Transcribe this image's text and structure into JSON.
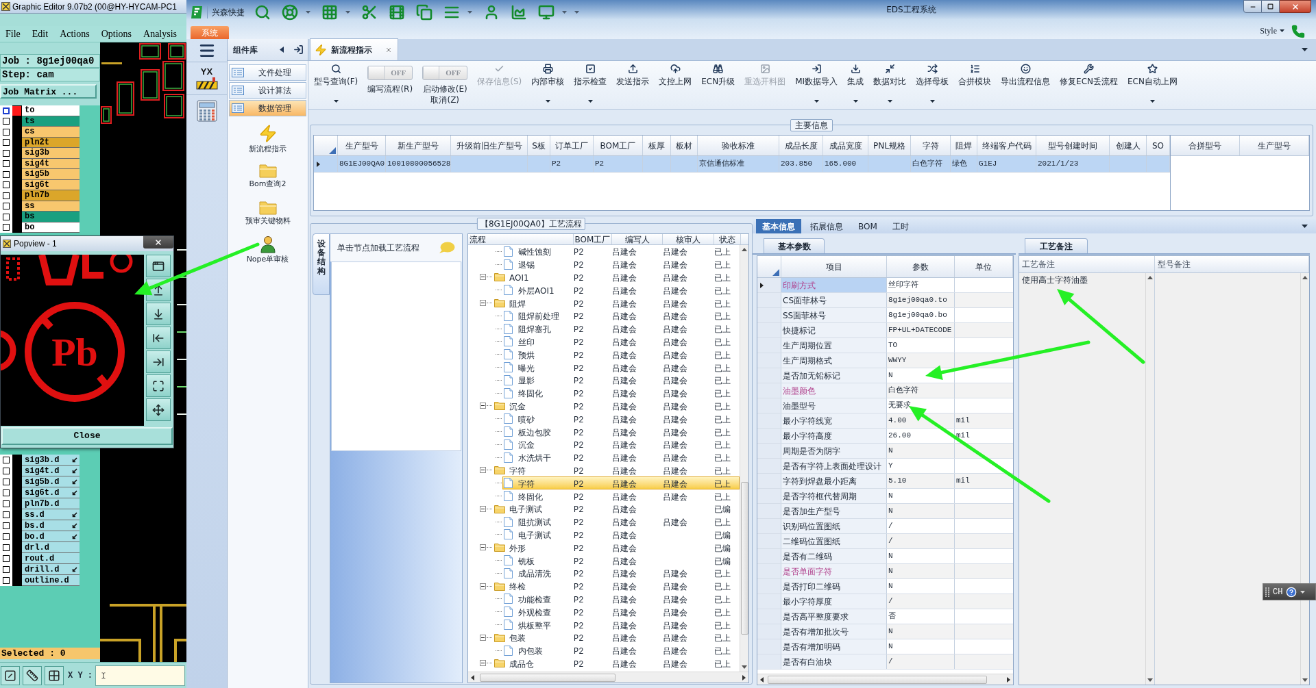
{
  "editor": {
    "title": "Graphic Editor 9.07b2 (00@HY-HYCAM-PC1",
    "menus": [
      "File",
      "Edit",
      "Actions",
      "Options",
      "Analysis"
    ],
    "job": "Job : 8g1ej00qa0",
    "step": "Step: cam",
    "job_matrix_button": "Job Matrix ...",
    "layers": [
      {
        "name": "to",
        "color": "#ffffff",
        "active": true,
        "checked": false
      },
      {
        "name": "ts",
        "color": "#1aa080",
        "active": false,
        "checked": false
      },
      {
        "name": "cs",
        "color": "#f8c76e",
        "active": false,
        "checked": false
      },
      {
        "name": "pln2t",
        "color": "#dba62a",
        "active": false,
        "checked": false
      },
      {
        "name": "sig3b",
        "color": "#f8c76e",
        "active": false,
        "checked": false
      },
      {
        "name": "sig4t",
        "color": "#f8c76e",
        "active": false,
        "checked": false
      },
      {
        "name": "sig5b",
        "color": "#f8c76e",
        "active": false,
        "checked": false
      },
      {
        "name": "sig6t",
        "color": "#f8c76e",
        "active": false,
        "checked": false
      },
      {
        "name": "pln7b",
        "color": "#dba62a",
        "active": false,
        "checked": false
      },
      {
        "name": "ss",
        "color": "#f8c76e",
        "active": false,
        "checked": false
      },
      {
        "name": "bs",
        "color": "#1aa080",
        "active": false,
        "checked": false
      },
      {
        "name": "bo",
        "color": "#ffffff",
        "active": false,
        "checked": false
      }
    ],
    "drill_layers": [
      {
        "name": "sig3b.d",
        "linked": true,
        "checked": false
      },
      {
        "name": "sig4t.d",
        "linked": true,
        "checked": false
      },
      {
        "name": "sig5b.d",
        "linked": true,
        "checked": false
      },
      {
        "name": "sig6t.d",
        "linked": true,
        "checked": false
      },
      {
        "name": "pln7b.d",
        "linked": false,
        "checked": false
      },
      {
        "name": "ss.d",
        "linked": true,
        "checked": false
      },
      {
        "name": "bs.d",
        "linked": true,
        "checked": false
      },
      {
        "name": "bo.d",
        "linked": true,
        "checked": false
      },
      {
        "name": "drl.d",
        "linked": false,
        "checked": false
      },
      {
        "name": "rout.d",
        "linked": false,
        "checked": false
      },
      {
        "name": "drill.d",
        "linked": true,
        "checked": false
      },
      {
        "name": "outline.d",
        "linked": false,
        "checked": false
      }
    ],
    "selected_count": "Selected : 0",
    "xy_label": "X Y :"
  },
  "popview": {
    "title": "Popview - 1",
    "symbol_text": "Pb",
    "close_button": "Close"
  },
  "window": {
    "brand": "兴森快捷",
    "title": "EDS工程系统",
    "ribbon_tabs": [
      {
        "label": "系统",
        "selected": true
      }
    ],
    "style_menu": "Style",
    "badge_text": "YX"
  },
  "library": {
    "title": "组件库",
    "categories": [
      {
        "label": "文件处理",
        "selected": false
      },
      {
        "label": "设计算法",
        "selected": false
      },
      {
        "label": "数据管理",
        "selected": true
      }
    ],
    "tools": [
      {
        "label": "新流程指示",
        "kind": "flow"
      },
      {
        "label": "Bom查询2",
        "kind": "folder"
      },
      {
        "label": "预审关键物料",
        "kind": "folder"
      },
      {
        "label": "Nope单审核",
        "kind": "user"
      }
    ]
  },
  "doc_tabs": [
    {
      "label": "新流程指示",
      "selected": true
    }
  ],
  "toolbar": [
    {
      "kind": "button",
      "label": "型号查询(F)",
      "dropdown": true,
      "disabled": false
    },
    {
      "kind": "toggle",
      "switch_text": "OFF",
      "on": false,
      "label": "编写流程(R)"
    },
    {
      "kind": "toggle",
      "switch_text": "OFF",
      "on": false,
      "label": "启动修改(E)",
      "sublabel": "取消(Z)"
    },
    {
      "kind": "button",
      "label": "保存信息(S)",
      "dropdown": false,
      "disabled": true
    },
    {
      "kind": "button",
      "label": "内部审核",
      "dropdown": true,
      "disabled": false
    },
    {
      "kind": "button",
      "label": "指示检查",
      "dropdown": true,
      "disabled": false
    },
    {
      "kind": "button",
      "label": "发送指示",
      "dropdown": false,
      "disabled": false
    },
    {
      "kind": "button",
      "label": "文控上网",
      "dropdown": false,
      "disabled": false
    },
    {
      "kind": "button",
      "label": "ECN升级",
      "dropdown": false,
      "disabled": false
    },
    {
      "kind": "button",
      "label": "重选开料图",
      "dropdown": false,
      "disabled": true
    },
    {
      "kind": "button",
      "label": "MI数据导入",
      "dropdown": true,
      "disabled": false
    },
    {
      "kind": "button",
      "label": "集成",
      "dropdown": true,
      "disabled": false
    },
    {
      "kind": "button",
      "label": "数据对比",
      "dropdown": true,
      "disabled": false
    },
    {
      "kind": "button",
      "label": "选择母板",
      "dropdown": true,
      "disabled": false
    },
    {
      "kind": "button",
      "label": "合拼模块",
      "dropdown": false,
      "disabled": false
    },
    {
      "kind": "button",
      "label": "导出流程信息",
      "dropdown": false,
      "disabled": false
    },
    {
      "kind": "button",
      "label": "修复ECN丢流程",
      "dropdown": false,
      "disabled": false
    },
    {
      "kind": "button",
      "label": "ECN自动上网",
      "dropdown": true,
      "disabled": false
    }
  ],
  "main_info": {
    "legend": "主要信息",
    "columns": [
      "生产型号",
      "新生产型号",
      "升级前旧生产型号",
      "S板",
      "订单工厂",
      "BOM工厂",
      "板厚",
      "板材",
      "验收标准",
      "成品长度",
      "成品宽度",
      "PNL规格",
      "字符",
      "阻焊",
      "终端客户代码",
      "型号创建时间",
      "创建人",
      "SO"
    ],
    "rows": [
      {
        "selected": true,
        "cells": [
          "8G1EJ00QA0",
          "10010800056528",
          null,
          null,
          "P2",
          "P2",
          null,
          null,
          "京信通信标准",
          "203.850",
          "165.000",
          null,
          "白色字符",
          "绿色",
          "G1EJ",
          "2021/1/23",
          null,
          null
        ]
      }
    ],
    "side_columns": [
      "合拼型号",
      "生产型号"
    ]
  },
  "process": {
    "legend": "【8G1EJ00QA0】工艺流程",
    "side_tab": "设备结构",
    "hint": "单击节点加载工艺流程",
    "columns": [
      "流程",
      "BOM工厂",
      "编写人",
      "核审人",
      "状态"
    ],
    "tree": [
      {
        "kind": "file",
        "cells": [
          "碱性蚀刻",
          "P2",
          "吕建会",
          "吕建会",
          "已上"
        ],
        "selected": false
      },
      {
        "kind": "file",
        "cells": [
          "退锡",
          "P2",
          "吕建会",
          "吕建会",
          "已上"
        ],
        "selected": false
      },
      {
        "kind": "folder",
        "cells": [
          "AOI1",
          "P2",
          "吕建会",
          "吕建会",
          "已上"
        ],
        "expanded": true,
        "selected": false,
        "children": [
          {
            "kind": "file",
            "cells": [
              "外层AOI1",
              "P2",
              "吕建会",
              "吕建会",
              "已上"
            ],
            "selected": false
          }
        ]
      },
      {
        "kind": "folder",
        "cells": [
          "阻焊",
          "P2",
          "吕建会",
          "吕建会",
          "已上"
        ],
        "expanded": true,
        "selected": false,
        "children": [
          {
            "kind": "file",
            "cells": [
              "阻焊前处理",
              "P2",
              "吕建会",
              "吕建会",
              "已上"
            ],
            "selected": false
          },
          {
            "kind": "file",
            "cells": [
              "阻焊塞孔",
              "P2",
              "吕建会",
              "吕建会",
              "已上"
            ],
            "selected": false
          },
          {
            "kind": "file",
            "cells": [
              "丝印",
              "P2",
              "吕建会",
              "吕建会",
              "已上"
            ],
            "selected": false
          },
          {
            "kind": "file",
            "cells": [
              "预烘",
              "P2",
              "吕建会",
              "吕建会",
              "已上"
            ],
            "selected": false
          },
          {
            "kind": "file",
            "cells": [
              "曝光",
              "P2",
              "吕建会",
              "吕建会",
              "已上"
            ],
            "selected": false
          },
          {
            "kind": "file",
            "cells": [
              "显影",
              "P2",
              "吕建会",
              "吕建会",
              "已上"
            ],
            "selected": false
          },
          {
            "kind": "file",
            "cells": [
              "终固化",
              "P2",
              "吕建会",
              "吕建会",
              "已上"
            ],
            "selected": false
          }
        ]
      },
      {
        "kind": "folder",
        "cells": [
          "沉金",
          "P2",
          "吕建会",
          "吕建会",
          "已上"
        ],
        "expanded": true,
        "selected": false,
        "children": [
          {
            "kind": "file",
            "cells": [
              "喷砂",
              "P2",
              "吕建会",
              "吕建会",
              "已上"
            ],
            "selected": false
          },
          {
            "kind": "file",
            "cells": [
              "板边包胶",
              "P2",
              "吕建会",
              "吕建会",
              "已上"
            ],
            "selected": false
          },
          {
            "kind": "file",
            "cells": [
              "沉金",
              "P2",
              "吕建会",
              "吕建会",
              "已上"
            ],
            "selected": false
          },
          {
            "kind": "file",
            "cells": [
              "水洗烘干",
              "P2",
              "吕建会",
              "吕建会",
              "已上"
            ],
            "selected": false
          }
        ]
      },
      {
        "kind": "folder",
        "cells": [
          "字符",
          "P2",
          "吕建会",
          "吕建会",
          "已上"
        ],
        "expanded": true,
        "selected": false,
        "children": [
          {
            "kind": "file",
            "cells": [
              "字符",
              "P2",
              "吕建会",
              "吕建会",
              "已上"
            ],
            "selected": true
          },
          {
            "kind": "file",
            "cells": [
              "终固化",
              "P2",
              "吕建会",
              "吕建会",
              "已上"
            ],
            "selected": false
          }
        ]
      },
      {
        "kind": "folder",
        "cells": [
          "电子测试",
          "P2",
          "吕建会",
          null,
          "已编"
        ],
        "expanded": true,
        "selected": false,
        "children": [
          {
            "kind": "file",
            "cells": [
              "阻抗测试",
              "P2",
              "吕建会",
              "吕建会",
              "已上"
            ],
            "selected": false
          },
          {
            "kind": "file",
            "cells": [
              "电子测试",
              "P2",
              "吕建会",
              null,
              "已编"
            ],
            "selected": false
          }
        ]
      },
      {
        "kind": "folder",
        "cells": [
          "外形",
          "P2",
          "吕建会",
          null,
          "已编"
        ],
        "expanded": true,
        "selected": false,
        "children": [
          {
            "kind": "file",
            "cells": [
              "铣板",
              "P2",
              "吕建会",
              null,
              "已编"
            ],
            "selected": false
          },
          {
            "kind": "file",
            "cells": [
              "成品清洗",
              "P2",
              "吕建会",
              "吕建会",
              "已上"
            ],
            "selected": false
          }
        ]
      },
      {
        "kind": "folder",
        "cells": [
          "终检",
          "P2",
          "吕建会",
          "吕建会",
          "已上"
        ],
        "expanded": true,
        "selected": false,
        "children": [
          {
            "kind": "file",
            "cells": [
              "功能检查",
              "P2",
              "吕建会",
              "吕建会",
              "已上"
            ],
            "selected": false
          },
          {
            "kind": "file",
            "cells": [
              "外观检查",
              "P2",
              "吕建会",
              "吕建会",
              "已上"
            ],
            "selected": false
          },
          {
            "kind": "file",
            "cells": [
              "烘板整平",
              "P2",
              "吕建会",
              "吕建会",
              "已上"
            ],
            "selected": false
          }
        ]
      },
      {
        "kind": "folder",
        "cells": [
          "包装",
          "P2",
          "吕建会",
          "吕建会",
          "已上"
        ],
        "expanded": true,
        "selected": false,
        "children": [
          {
            "kind": "file",
            "cells": [
              "内包装",
              "P2",
              "吕建会",
              "吕建会",
              "已上"
            ],
            "selected": false
          }
        ]
      },
      {
        "kind": "folder",
        "cells": [
          "成品仓",
          "P2",
          "吕建会",
          "吕建会",
          "已上"
        ],
        "expanded": true,
        "selected": false
      }
    ]
  },
  "info": {
    "tabs": [
      {
        "label": "基本信息",
        "selected": true
      },
      {
        "label": "拓展信息",
        "selected": false
      },
      {
        "label": "BOM",
        "selected": false
      },
      {
        "label": "工时",
        "selected": false
      }
    ],
    "params_tab": "基本参数",
    "param_columns": [
      "项目",
      "参数",
      "单位"
    ],
    "params": [
      {
        "item": "印刷方式",
        "value": "丝印字符",
        "flagged": true,
        "selected": true
      },
      {
        "item": "CS面菲林号",
        "value": "8g1ej00qa0.to",
        "flagged": false,
        "selected": false
      },
      {
        "item": "SS面菲林号",
        "value": "8g1ej00qa0.bo",
        "flagged": false,
        "selected": false
      },
      {
        "item": "快捷标记",
        "value": "FP+UL+DATECODE",
        "flagged": false,
        "selected": false
      },
      {
        "item": "生产周期位置",
        "value": "TO",
        "flagged": false,
        "selected": false
      },
      {
        "item": "生产周期格式",
        "value": "WWYY",
        "flagged": false,
        "selected": false
      },
      {
        "item": "是否加无铅标记",
        "value": "N",
        "flagged": false,
        "selected": false
      },
      {
        "item": "油墨颜色",
        "value": "白色字符",
        "flagged": true,
        "selected": false
      },
      {
        "item": "油墨型号",
        "value": "无要求",
        "flagged": false,
        "selected": false
      },
      {
        "item": "最小字符线宽",
        "value": "4.00",
        "unit": "mil",
        "flagged": false,
        "selected": false
      },
      {
        "item": "最小字符高度",
        "value": "26.00",
        "unit": "mil",
        "flagged": false,
        "selected": false
      },
      {
        "item": "周期是否为阴字",
        "value": "N",
        "flagged": false,
        "selected": false
      },
      {
        "item": "是否有字符上表面处理设计",
        "value": "Y",
        "flagged": false,
        "selected": false
      },
      {
        "item": "字符到焊盘最小距离",
        "value": "5.10",
        "unit": "mil",
        "flagged": false,
        "selected": false
      },
      {
        "item": "是否字符框代替周期",
        "value": "N",
        "flagged": false,
        "selected": false
      },
      {
        "item": "是否加生产型号",
        "value": "N",
        "flagged": false,
        "selected": false
      },
      {
        "item": "识别码位置图纸",
        "value": "/",
        "flagged": false,
        "selected": false
      },
      {
        "item": "二维码位置图纸",
        "value": "/",
        "flagged": false,
        "selected": false
      },
      {
        "item": "是否有二维码",
        "value": "N",
        "flagged": false,
        "selected": false
      },
      {
        "item": "是否单面字符",
        "value": "N",
        "flagged": true,
        "selected": false
      },
      {
        "item": "是否打印二维码",
        "value": "N",
        "flagged": false,
        "selected": false
      },
      {
        "item": "最小字符厚度",
        "value": "/",
        "flagged": false,
        "selected": false
      },
      {
        "item": "是否高平整度要求",
        "value": "否",
        "flagged": false,
        "selected": false
      },
      {
        "item": "是否有增加批次号",
        "value": "N",
        "flagged": false,
        "selected": false
      },
      {
        "item": "是否有增加明码",
        "value": "N",
        "flagged": false,
        "selected": false
      },
      {
        "item": "是否有白油块",
        "value": "/",
        "flagged": false,
        "selected": false
      }
    ],
    "remarks_tab": "工艺备注",
    "remark_columns": [
      "工艺备注",
      "型号备注"
    ],
    "remarks": [
      "使用高士字符油墨"
    ]
  },
  "language_bar": {
    "label": "CH"
  }
}
